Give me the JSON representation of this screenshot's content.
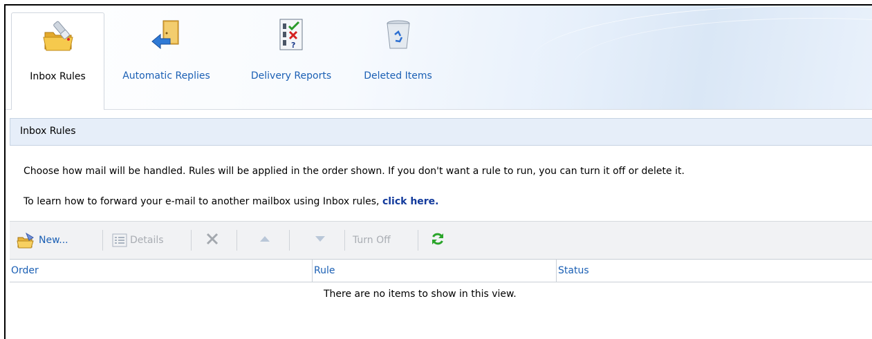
{
  "tabs": [
    {
      "label": "Inbox Rules",
      "icon": "folder-rules-icon",
      "active": true
    },
    {
      "label": "Automatic Replies",
      "icon": "auto-reply-door-icon",
      "active": false
    },
    {
      "label": "Delivery Reports",
      "icon": "delivery-report-checklist-icon",
      "active": false
    },
    {
      "label": "Deleted Items",
      "icon": "recycle-bin-icon",
      "active": false
    }
  ],
  "section": {
    "title": "Inbox Rules"
  },
  "description": {
    "line1": "Choose how mail will be handled. Rules will be applied in the order shown. If you don't want a rule to run, you can turn it off or delete it.",
    "line2_prefix": "To learn how to forward your e-mail to another mailbox using Inbox rules,",
    "line2_link": "click here."
  },
  "toolbar": {
    "new_label": "New...",
    "details_label": "Details",
    "turn_off_label": "Turn Off"
  },
  "grid": {
    "columns": [
      "Order",
      "Rule",
      "Status"
    ],
    "empty_message": "There are no items to show in this view."
  },
  "colors": {
    "link": "#1a5fb4",
    "refresh": "#2aa52a",
    "header_bg": "#e6eef9"
  }
}
